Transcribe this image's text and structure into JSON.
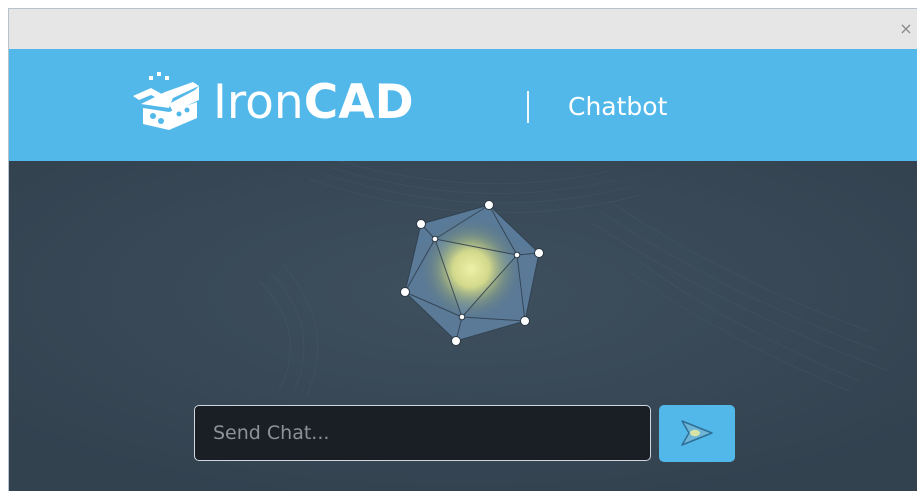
{
  "window": {
    "close_label": "×"
  },
  "banner": {
    "logo_text_light": "Iron",
    "logo_text_bold": "CAD",
    "subtitle": "Chatbot"
  },
  "chat": {
    "input_value": "",
    "input_placeholder": "Send Chat..."
  },
  "icons": {
    "logo": "ironcad-logo-icon",
    "orb": "chatbot-orb-icon",
    "send": "send-arrow-icon",
    "close": "close-icon"
  },
  "colors": {
    "banner_bg": "#52b8ea",
    "chat_bg": "#394a59",
    "titlebar_bg": "#e6e6e6",
    "input_bg": "#1a1f26",
    "send_button_bg": "#52b8ea"
  }
}
